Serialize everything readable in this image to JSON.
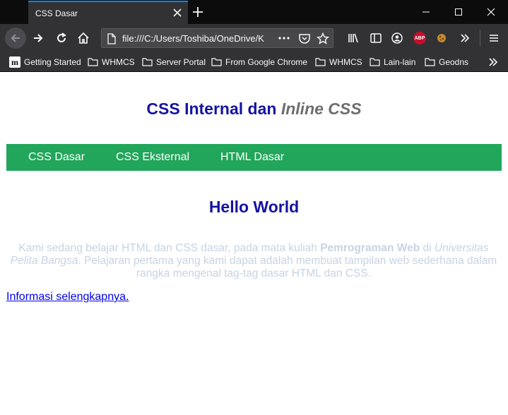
{
  "browser": {
    "tab_title": "CSS Dasar",
    "url": "file:///C:/Users/Toshiba/OneDrive/K",
    "bookmarks": [
      {
        "label": "Getting Started",
        "icon": "m-logo-icon"
      },
      {
        "label": "WHMCS",
        "icon": "folder-icon"
      },
      {
        "label": "Server Portal",
        "icon": "folder-icon"
      },
      {
        "label": "From Google Chrome",
        "icon": "folder-icon"
      },
      {
        "label": "WHMCS",
        "icon": "folder-icon"
      },
      {
        "label": "Lain-lain",
        "icon": "folder-icon"
      },
      {
        "label": "Geodns",
        "icon": "folder-icon"
      }
    ],
    "abp_label": "ABP",
    "accent": "#0a84ff"
  },
  "page": {
    "heading_main": "CSS Internal dan ",
    "heading_italic": "Inline CSS",
    "menu": [
      "CSS Dasar",
      "CSS Eksternal",
      "HTML Dasar"
    ],
    "hello": "Hello World",
    "para_1": "Kami sedang belajar HTML dan CSS dasar, pada mata kuliah ",
    "para_bold": "Pemrograman Web",
    "para_2": " di ",
    "para_italic": "Universitas Pelita Bangsa",
    "para_3": ". Pelajaran pertama yang kami dapat adalah membuat tampilan web sederhana dalam rangka mengenal tag-tag dasar HTML dan CSS.",
    "more_link": "Informasi selengkapnya.",
    "colors": {
      "heading": "#1414a0",
      "menu_bg": "#22a65b",
      "paragraph": "#c7d4e2",
      "link": "#0000ee"
    }
  }
}
